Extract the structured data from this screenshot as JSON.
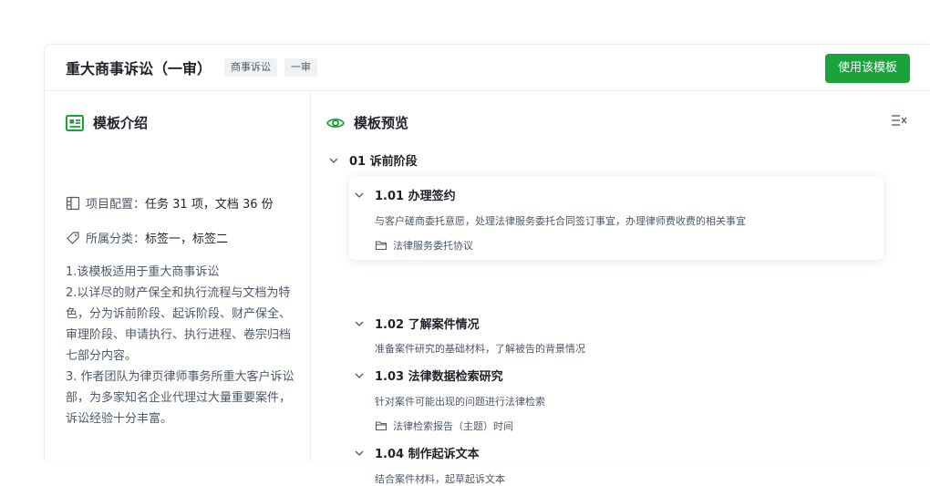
{
  "header": {
    "title": "重大商事诉讼（一审）",
    "tags": [
      "商事诉讼",
      "一审"
    ],
    "use_button": "使用该模板"
  },
  "left": {
    "heading": "模板介绍",
    "config_label": "项目配置：",
    "config_value": "任务 31 项，文档 36 份",
    "category_label": "所属分类：",
    "category_value": "标签一，标签二",
    "intro": [
      "1.该模板适用于重大商事诉讼",
      "2.以详尽的财产保全和执行流程与文档为特色，分为诉前阶段、起诉阶段、财产保全、审理阶段、申请执行、执行进程、卷宗归档七部分内容。",
      "3. 作者团队为律页律师事务所重大客户诉讼部，为多家知名企业代理过大量重要案件，诉讼经验十分丰富。"
    ]
  },
  "right": {
    "heading": "模板预览",
    "phase": "01 诉前阶段",
    "tasks": [
      {
        "title": "1.01 办理签约",
        "desc": "与客户磋商委托意愿，处理法律服务委托合同签订事宜，办理律师费收费的相关事宜",
        "file": "法律服务委托协议"
      },
      {
        "title": "1.02 了解案件情况",
        "desc": "准备案件研究的基础材料，了解被告的背景情况"
      },
      {
        "title": "1.03  法律数据检索研究",
        "desc": "针对案件可能出现的问题进行法律检索",
        "file": "法律检索报告（主题）时间"
      },
      {
        "title": "1.04  制作起诉文本",
        "desc": "结合案件材料，起草起诉文本"
      }
    ]
  },
  "colors": {
    "accent": "#1aa33b",
    "text": "#1f2329",
    "muted": "#4e5969",
    "border": "#ebedf0"
  }
}
